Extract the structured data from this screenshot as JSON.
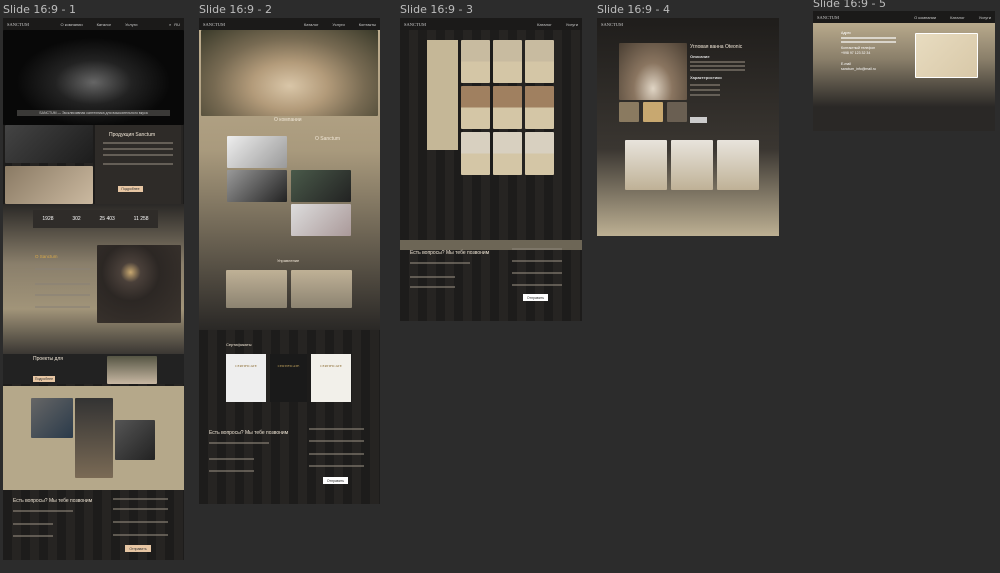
{
  "frames": [
    {
      "label": "Slide 16:9 - 1"
    },
    {
      "label": "Slide 16:9 - 2"
    },
    {
      "label": "Slide 16:9 - 3"
    },
    {
      "label": "Slide 16:9 - 4"
    },
    {
      "label": "Slide 16:9 - 5"
    }
  ],
  "nav": {
    "logo": "SANCTUM",
    "items": [
      "О компании",
      "Каталог",
      "Услуги",
      "Контакты"
    ],
    "lang": "RU"
  },
  "slide1": {
    "hero_caption": "SANCTUM — Эксклюзивная сантехника для взыскательного вкуса",
    "products_title": "Продукция Sanctum",
    "more_button": "Подробнее",
    "stats": [
      "1928",
      "302",
      "25 403",
      "11 258"
    ],
    "about_title": "О Sanctum",
    "projects_title": "Проекты для",
    "projects_button": "Подробнее",
    "contact_title": "Есть вопросы? Мы тебе позвоним",
    "send_button": "Отправить"
  },
  "slide2": {
    "hero_title": "О компании",
    "about_title": "О Sanctum",
    "management_title": "Управление",
    "certs_title": "Сертификаты",
    "cert_text": "CERTIFICATE",
    "contact_title": "Есть вопросы? Мы тебе позвоним",
    "send_button": "Отправить"
  },
  "slide3": {
    "contact_title": "Есть вопросы? Мы тебе позвоним",
    "send_button": "Отправить"
  },
  "slide4": {
    "product_title": "Угловая ванна Oteonic",
    "desc_title": "Описание",
    "specs_title": "Характеристики"
  },
  "slide5": {
    "address_label": "Адрес",
    "phone_label": "Контактный телефон",
    "phone": "+998 97 123 32 34",
    "email_label": "E-mail",
    "email": "sanctum_info@mail.ru"
  }
}
